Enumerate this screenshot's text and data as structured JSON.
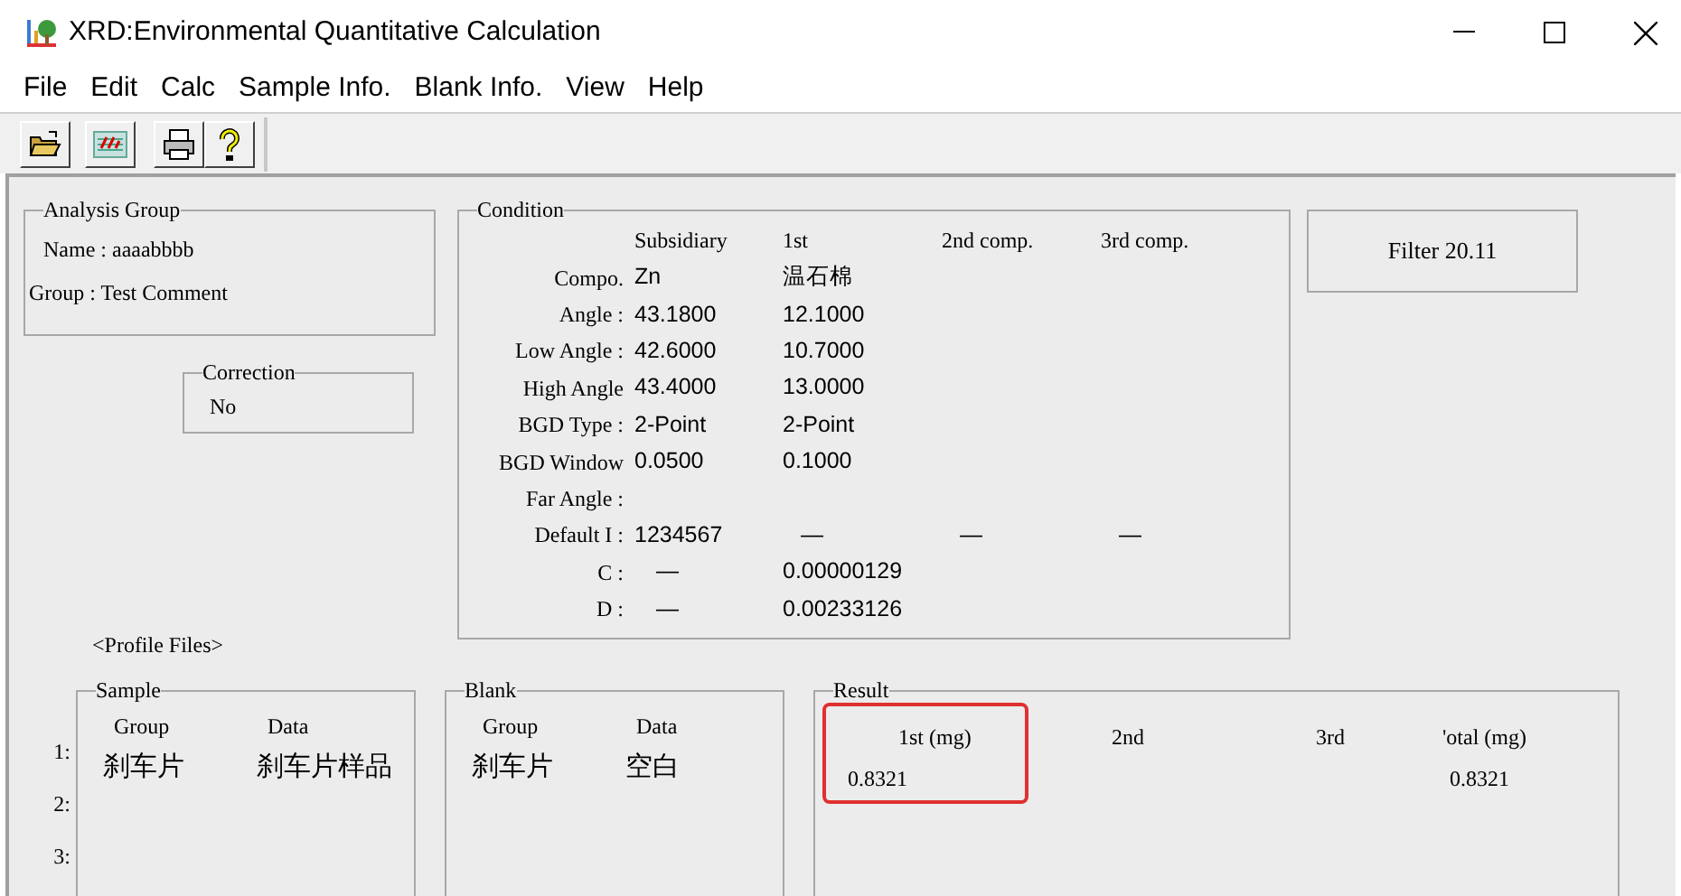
{
  "window": {
    "title": "XRD:Environmental Quantitative Calculation"
  },
  "menu": [
    "File",
    "Edit",
    "Calc",
    "Sample Info.",
    "Blank Info.",
    "View",
    "Help"
  ],
  "toolbar": [
    {
      "kind": "open"
    },
    {
      "kind": "report"
    },
    {
      "kind": "print"
    },
    {
      "kind": "help"
    }
  ],
  "analysis_group": {
    "title": "Analysis Group",
    "lines": [
      "Name : aaaabbbb",
      "Group : Test Comment"
    ]
  },
  "correction": {
    "title": "Correction",
    "value": "No"
  },
  "condition": {
    "title": "Condition",
    "header": [
      "Subsidiary",
      "1st",
      "2nd comp.",
      "3rd comp."
    ],
    "rows": [
      {
        "label": "Compo.",
        "values": [
          "Zn",
          "温石棉"
        ]
      },
      {
        "label": "Angle :",
        "values": [
          "43.1800",
          "12.1000"
        ]
      },
      {
        "label": "Low Angle :",
        "values": [
          "42.6000",
          "10.7000"
        ]
      },
      {
        "label": "High Angle",
        "values": [
          "43.4000",
          "13.0000"
        ]
      },
      {
        "label": "BGD Type :",
        "values": [
          "2-Point",
          "2-Point"
        ]
      },
      {
        "label": "BGD Window",
        "values": [
          "0.0500",
          "0.1000"
        ]
      },
      {
        "label": "Far Angle :",
        "values": []
      },
      {
        "label": "Default I :",
        "values": [
          "1234567",
          "—",
          "—",
          "—"
        ]
      },
      {
        "label": "C :",
        "values": [
          "—",
          "0.00000129"
        ]
      },
      {
        "label": "D :",
        "values": [
          "—",
          "0.00233126"
        ]
      }
    ]
  },
  "filter": "Filter 20.11",
  "profile_files": "<Profile Files>",
  "row_numbers": [
    "1:",
    "2:",
    "3:"
  ],
  "sample": {
    "title": "Sample",
    "columns": [
      "Group",
      "Data"
    ],
    "rows": [
      [
        "刹车片",
        "刹车片样品"
      ]
    ]
  },
  "blank": {
    "title": "Blank",
    "columns": [
      "Group",
      "Data"
    ],
    "rows": [
      [
        "刹车片",
        "空白"
      ]
    ]
  },
  "result": {
    "title": "Result",
    "columns": [
      {
        "label": "1st (mg)",
        "values": [
          "0.8321"
        ],
        "highlighted": true
      },
      {
        "label": "2nd",
        "highlighted": false
      },
      {
        "label": "3rd",
        "highlighted": false
      },
      {
        "label": "'otal (mg)",
        "values": [
          "0.8321"
        ],
        "highlighted": false
      }
    ]
  }
}
